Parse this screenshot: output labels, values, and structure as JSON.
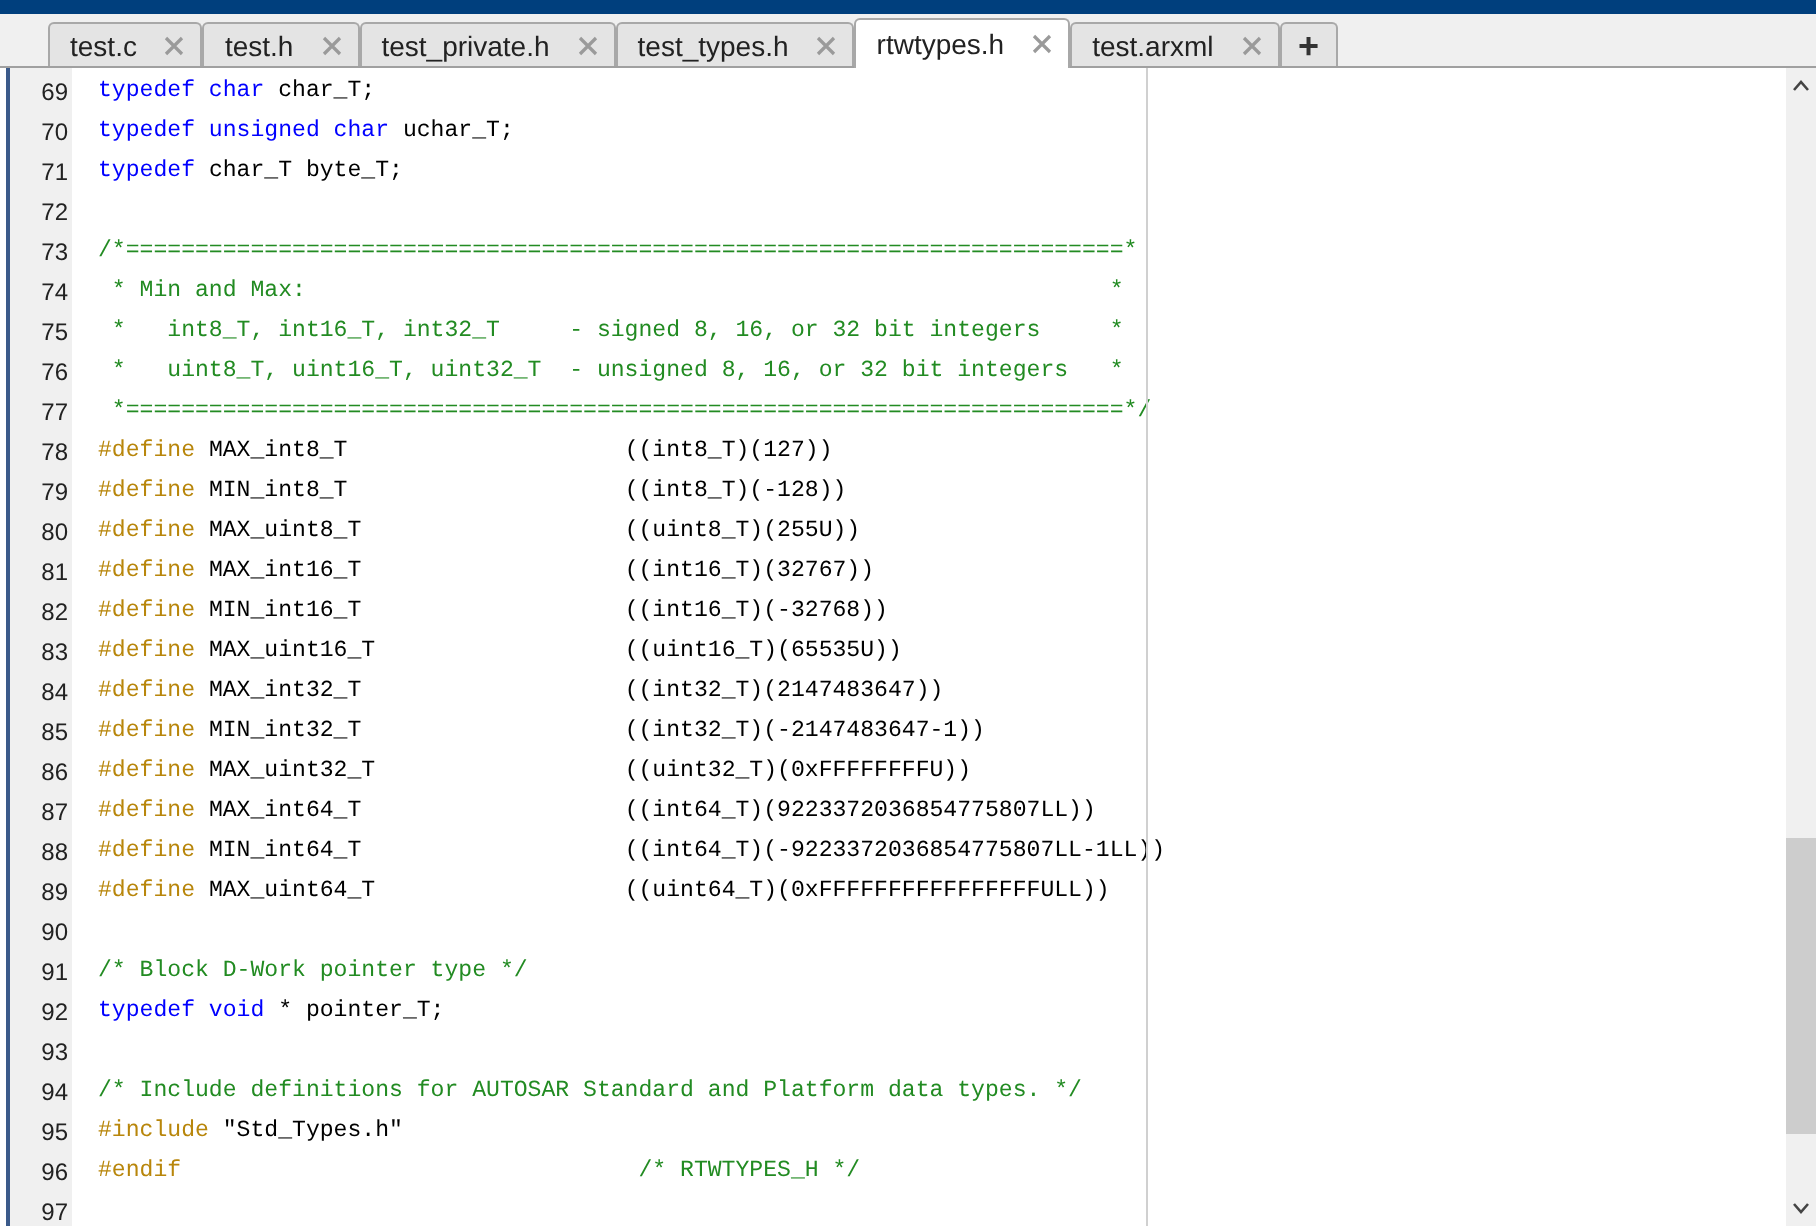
{
  "tabs": [
    {
      "label": "test.c",
      "selected": false
    },
    {
      "label": "test.h",
      "selected": false
    },
    {
      "label": "test_private.h",
      "selected": false
    },
    {
      "label": "test_types.h",
      "selected": false
    },
    {
      "label": "rtwtypes.h",
      "selected": true
    },
    {
      "label": "test.arxml",
      "selected": false
    }
  ],
  "new_tab": "+",
  "lines": [
    {
      "number": "69",
      "kind": "code",
      "tokens": [
        {
          "kind": "keyword",
          "text": "typedef char"
        },
        {
          "kind": "plain",
          "text": " char_T;"
        }
      ]
    },
    {
      "number": "70",
      "kind": "code",
      "tokens": [
        {
          "kind": "keyword",
          "text": "typedef unsigned char"
        },
        {
          "kind": "plain",
          "text": " uchar_T;"
        }
      ]
    },
    {
      "number": "71",
      "kind": "code",
      "tokens": [
        {
          "kind": "keyword",
          "text": "typedef"
        },
        {
          "kind": "plain",
          "text": " char_T byte_T;"
        }
      ]
    },
    {
      "number": "72",
      "kind": "blank"
    },
    {
      "number": "73",
      "kind": "code",
      "tokens": [
        {
          "kind": "comment",
          "text": "/*========================================================================*"
        }
      ]
    },
    {
      "number": "74",
      "kind": "code",
      "tokens": [
        {
          "kind": "comment",
          "text": " * Min and Max:                                                          *"
        }
      ]
    },
    {
      "number": "75",
      "kind": "code",
      "tokens": [
        {
          "kind": "comment",
          "text": " *   int8_T, int16_T, int32_T     - signed 8, 16, or 32 bit integers     *"
        }
      ]
    },
    {
      "number": "76",
      "kind": "code",
      "tokens": [
        {
          "kind": "comment",
          "text": " *   uint8_T, uint16_T, uint32_T  - unsigned 8, 16, or 32 bit integers   *"
        }
      ]
    },
    {
      "number": "77",
      "kind": "code",
      "tokens": [
        {
          "kind": "comment",
          "text": " *========================================================================*/"
        }
      ]
    },
    {
      "number": "78",
      "kind": "define",
      "directive": "#define",
      "name": "MAX_int8_T",
      "value": "((int8_T)(127))"
    },
    {
      "number": "79",
      "kind": "define",
      "directive": "#define",
      "name": "MIN_int8_T",
      "value": "((int8_T)(-128))"
    },
    {
      "number": "80",
      "kind": "define",
      "directive": "#define",
      "name": "MAX_uint8_T",
      "value": "((uint8_T)(255U))"
    },
    {
      "number": "81",
      "kind": "define",
      "directive": "#define",
      "name": "MAX_int16_T",
      "value": "((int16_T)(32767))"
    },
    {
      "number": "82",
      "kind": "define",
      "directive": "#define",
      "name": "MIN_int16_T",
      "value": "((int16_T)(-32768))"
    },
    {
      "number": "83",
      "kind": "define",
      "directive": "#define",
      "name": "MAX_uint16_T",
      "value": "((uint16_T)(65535U))"
    },
    {
      "number": "84",
      "kind": "define",
      "directive": "#define",
      "name": "MAX_int32_T",
      "value": "((int32_T)(2147483647))"
    },
    {
      "number": "85",
      "kind": "define",
      "directive": "#define",
      "name": "MIN_int32_T",
      "value": "((int32_T)(-2147483647-1))"
    },
    {
      "number": "86",
      "kind": "define",
      "directive": "#define",
      "name": "MAX_uint32_T",
      "value": "((uint32_T)(0xFFFFFFFFU))"
    },
    {
      "number": "87",
      "kind": "define",
      "directive": "#define",
      "name": "MAX_int64_T",
      "value": "((int64_T)(9223372036854775807LL))"
    },
    {
      "number": "88",
      "kind": "define",
      "directive": "#define",
      "name": "MIN_int64_T",
      "value": "((int64_T)(-9223372036854775807LL-1LL))"
    },
    {
      "number": "89",
      "kind": "define",
      "directive": "#define",
      "name": "MAX_uint64_T",
      "value": "((uint64_T)(0xFFFFFFFFFFFFFFFFULL))"
    },
    {
      "number": "90",
      "kind": "blank"
    },
    {
      "number": "91",
      "kind": "code",
      "tokens": [
        {
          "kind": "comment",
          "text": "/* Block D-Work pointer type */"
        }
      ]
    },
    {
      "number": "92",
      "kind": "code",
      "tokens": [
        {
          "kind": "keyword",
          "text": "typedef void"
        },
        {
          "kind": "plain",
          "text": " * pointer_T;"
        }
      ]
    },
    {
      "number": "93",
      "kind": "blank"
    },
    {
      "number": "94",
      "kind": "code",
      "tokens": [
        {
          "kind": "comment",
          "text": "/* Include definitions for AUTOSAR Standard and Platform data types. */"
        }
      ]
    },
    {
      "number": "95",
      "kind": "code",
      "tokens": [
        {
          "kind": "preproc",
          "text": "#include"
        },
        {
          "kind": "plain",
          "text": " \"Std_Types.h\""
        }
      ]
    },
    {
      "number": "96",
      "kind": "endif",
      "directive": "#endif",
      "comment": "/* RTWTYPES_H */"
    },
    {
      "number": "97",
      "kind": "blank"
    }
  ]
}
